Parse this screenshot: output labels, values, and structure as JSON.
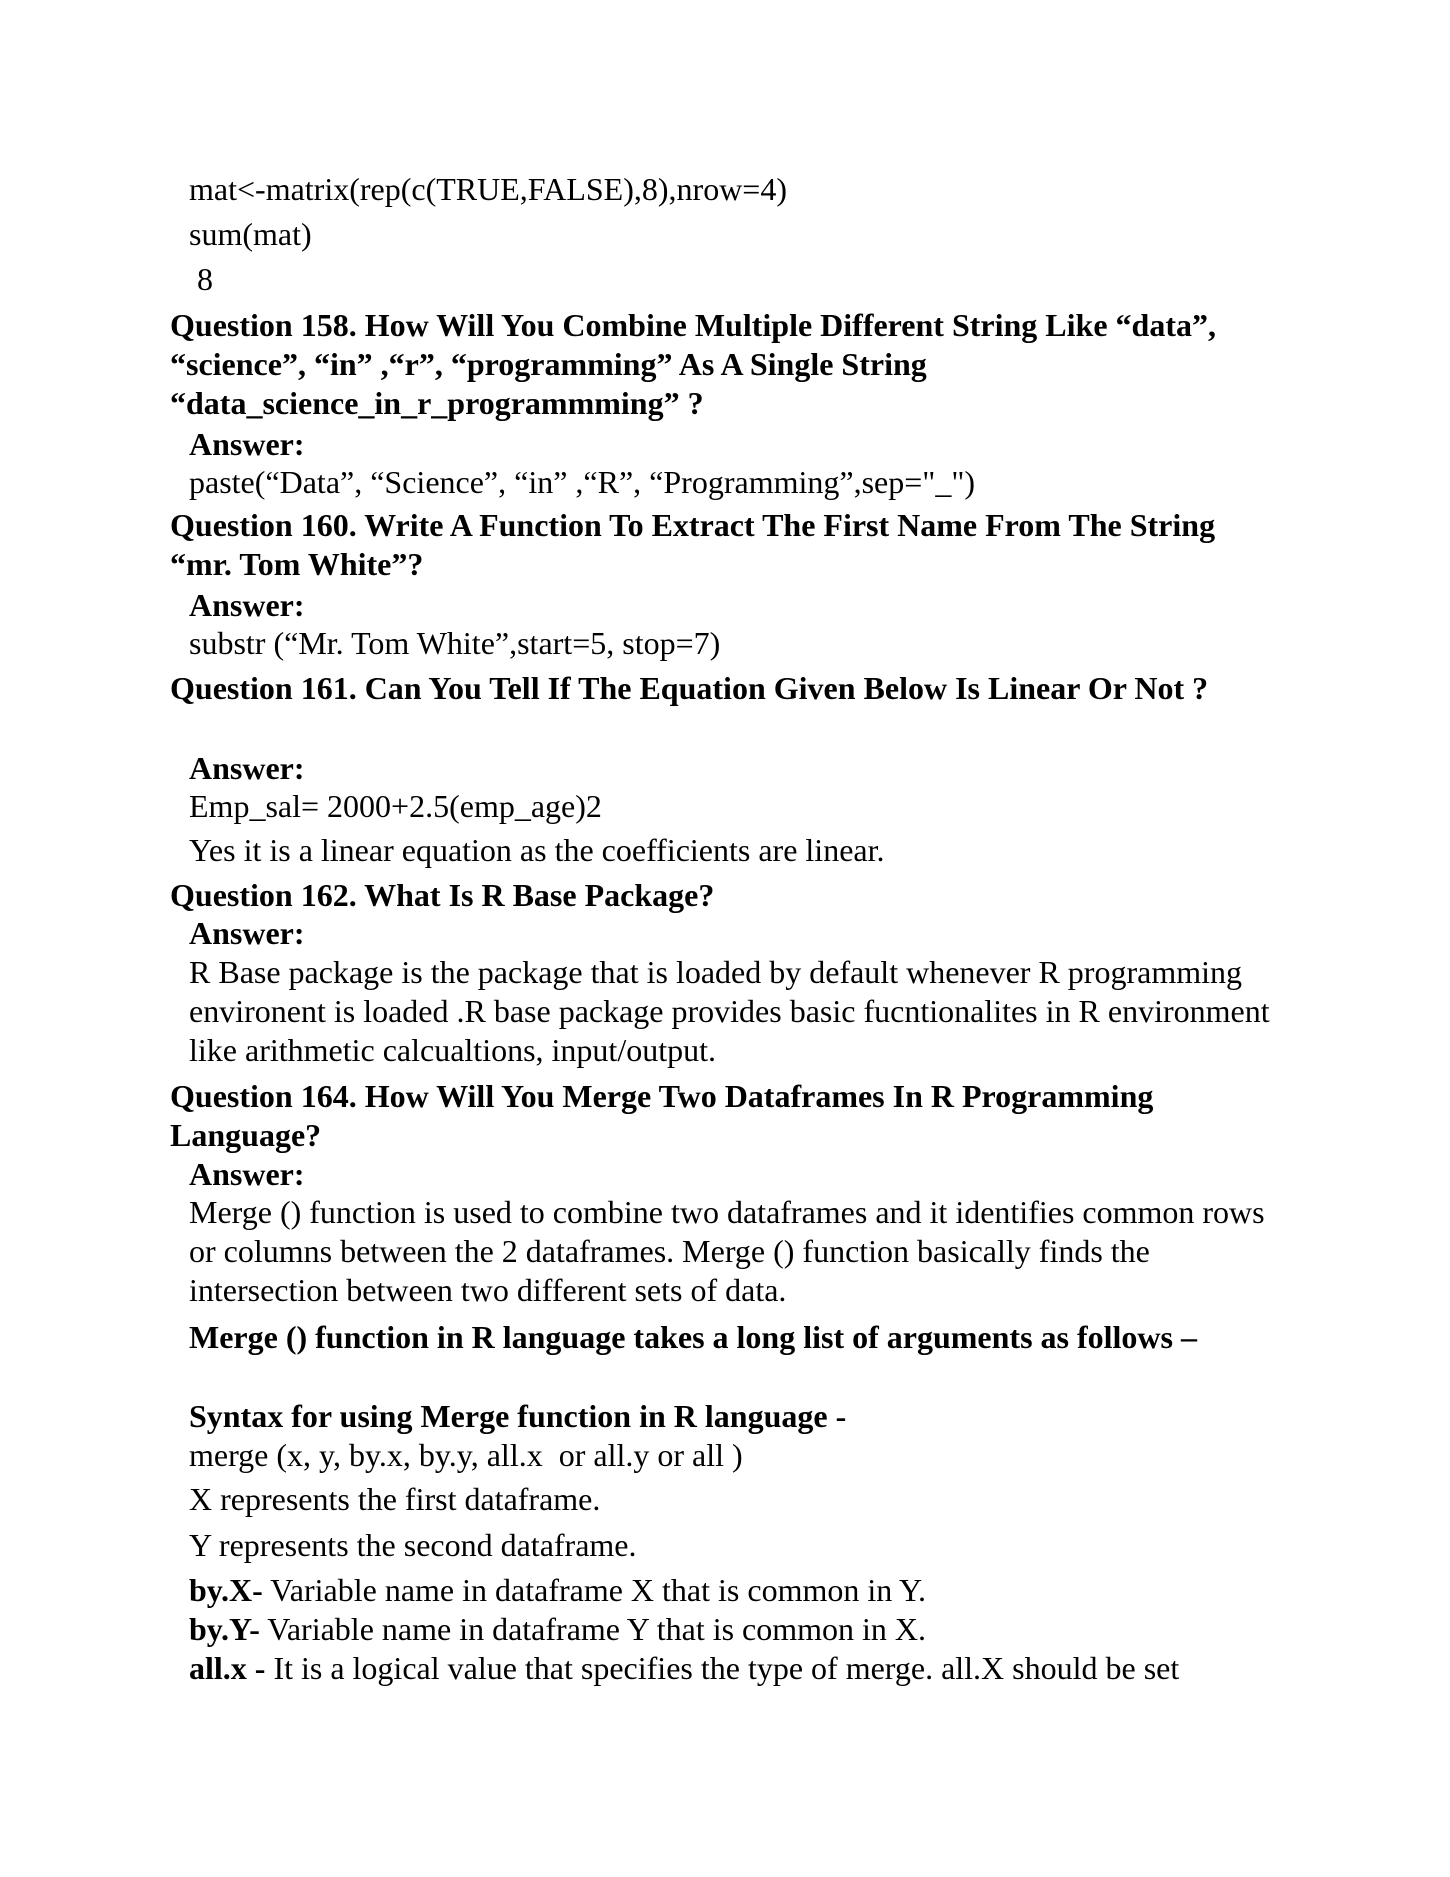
{
  "top": {
    "code1": "mat<-matrix(rep(c(TRUE,FALSE),8),nrow=4)",
    "code2": "sum(mat)",
    "result": " 8"
  },
  "q158": {
    "question": "Question 158. How Will You Combine Multiple Different String Like “data”, “science”, “in” ,“r”, “programming” As A Single String “data_science_in_r_programmming” ?",
    "answer_label": "Answer:",
    "code": "paste(“Data”, “Science”, “in” ,“R”, “Programming”,sep=\"_\")"
  },
  "q160": {
    "question": "Question 160. Write A Function To Extract The First Name From The String “mr. Tom White”?",
    "answer_label": "Answer:",
    "code": "substr (“Mr. Tom White”,start=5, stop=7)"
  },
  "q161": {
    "question": "Question 161. Can You Tell If The Equation Given Below Is Linear Or Not ?",
    "answer_label": "Answer:",
    "equation": "Emp_sal= 2000+2.5(emp_age)2",
    "explanation": "Yes it is a linear equation as the coefficients are linear."
  },
  "q162": {
    "question": "Question 162. What Is R Base Package?",
    "answer_label": "Answer:",
    "text": "R Base package is the package that is loaded by default whenever R programming environent is loaded .R base package provides basic fucntionalites in R environment like arithmetic calcualtions, input/output."
  },
  "q164": {
    "question": "Question 164. How Will You Merge Two Dataframes In R Programming Language?",
    "answer_label": "Answer:",
    "text": "Merge () function is used to combine two dataframes and it identifies common rows or columns between the 2 dataframes. Merge () function basically finds the intersection between two different sets of data.",
    "args_heading": "Merge () function in R language takes a long list of arguments as follows –",
    "syntax_heading": "Syntax for using Merge function in R language -",
    "syntax": "merge (x, y, by.x, by.y, all.x  or all.y or all )",
    "x_desc": "X represents the first dataframe.",
    "y_desc": "Y represents the second dataframe.",
    "byx_term": "by.X-",
    "byx_desc": " Variable name in dataframe X that is common in Y.",
    "byy_term": "by.Y-",
    "byy_desc": " Variable name in dataframe Y that is common in X.",
    "allx_term": "all.x -",
    "allx_desc": " It is a logical value that specifies the type of merge. all.X should be set"
  }
}
